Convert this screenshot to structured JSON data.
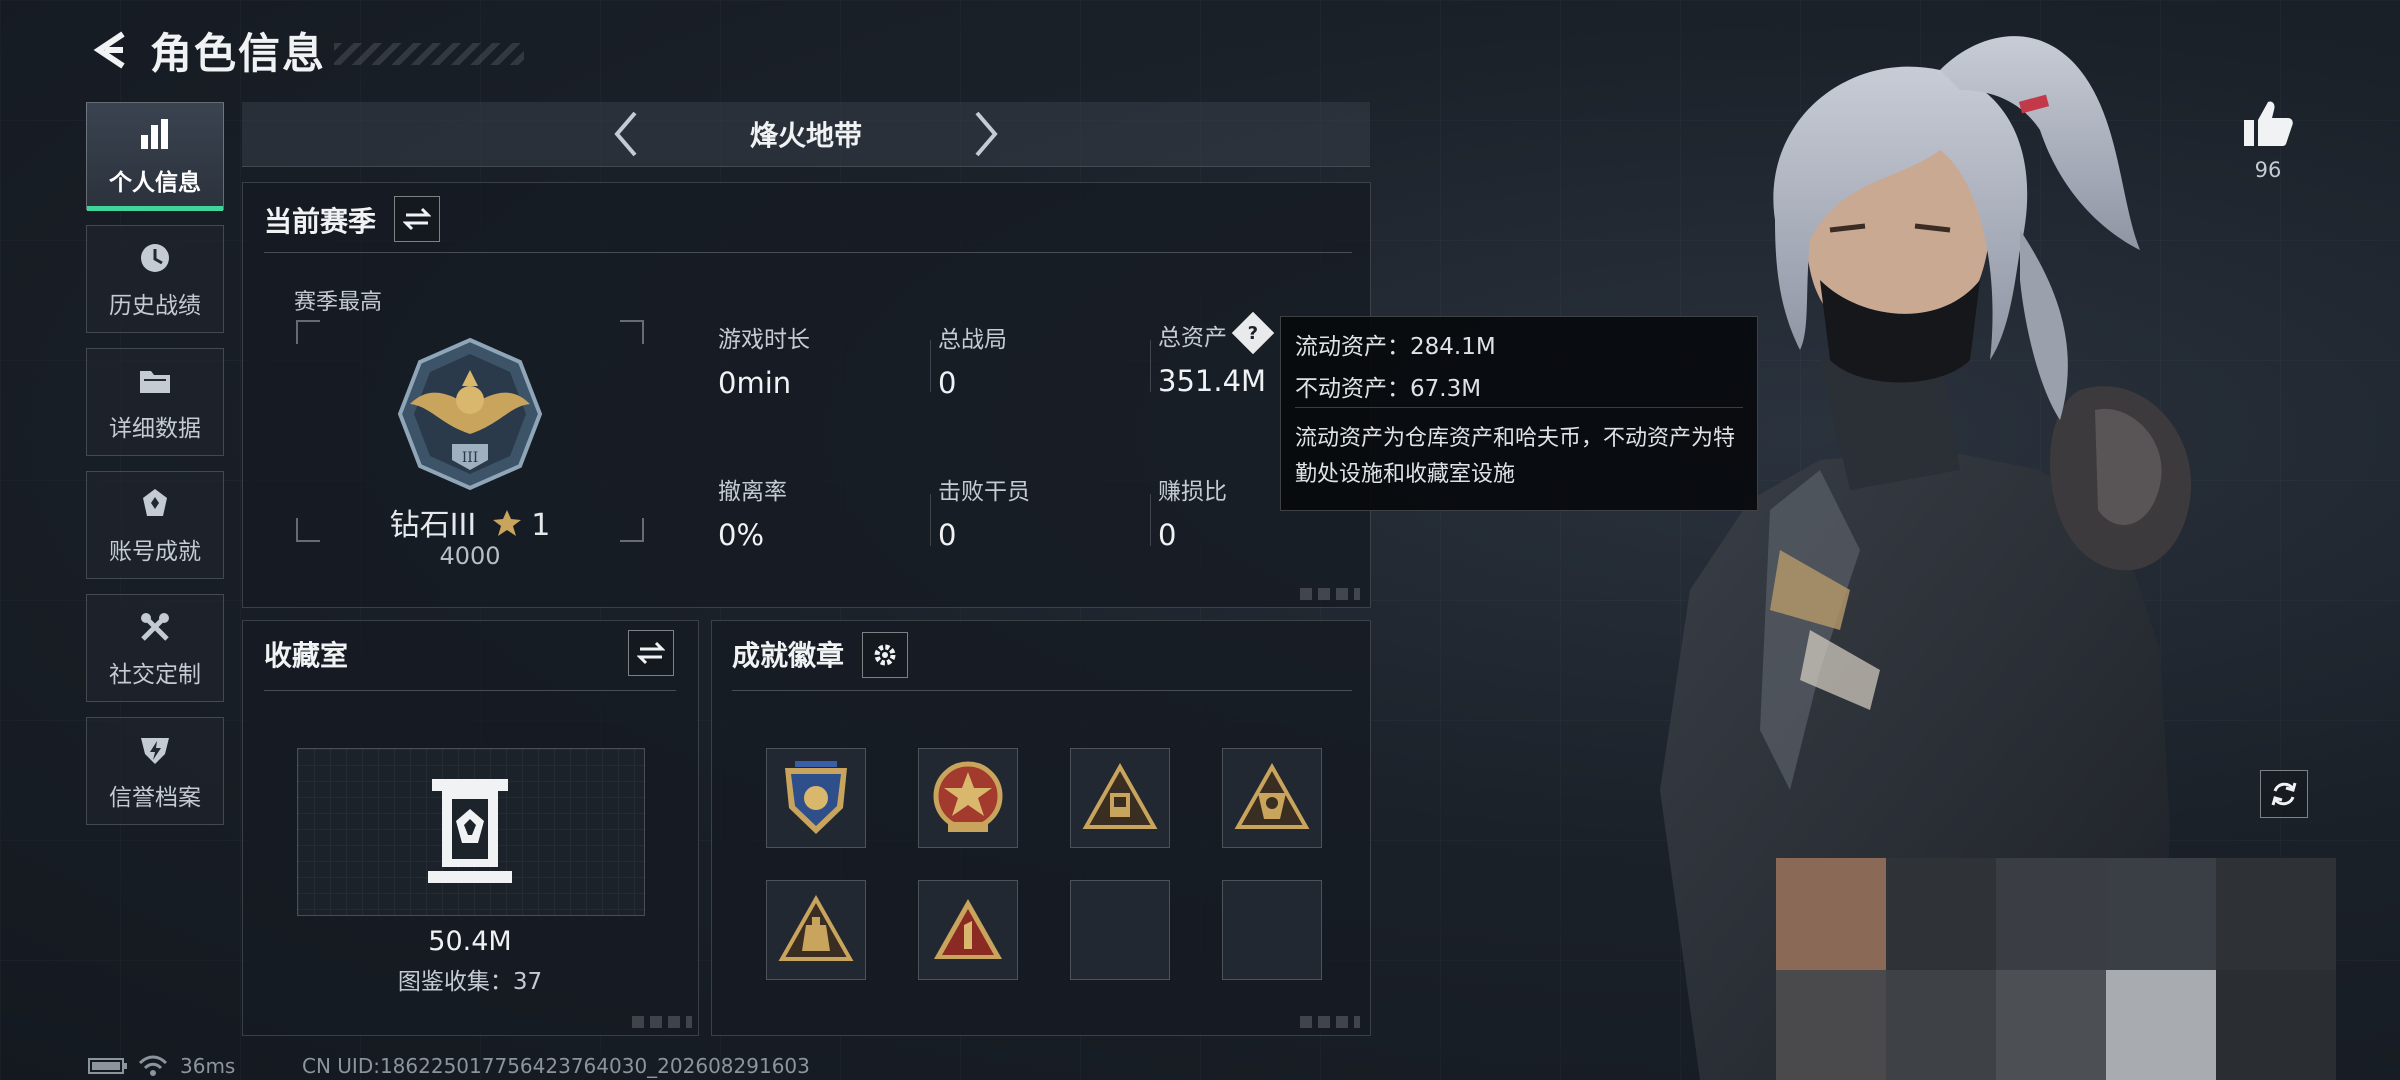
{
  "header": {
    "title": "角色信息"
  },
  "sidenav": {
    "items": [
      {
        "label": "个人信息",
        "icon": "bar-chart-icon",
        "active": true
      },
      {
        "label": "历史战绩",
        "icon": "history-icon",
        "active": false
      },
      {
        "label": "详细数据",
        "icon": "folder-icon",
        "active": false
      },
      {
        "label": "账号成就",
        "icon": "achievement-icon",
        "active": false
      },
      {
        "label": "社交定制",
        "icon": "tools-icon",
        "active": false
      },
      {
        "label": "信誉档案",
        "icon": "shield-icon",
        "active": false
      }
    ]
  },
  "mode": {
    "title": "烽火地带"
  },
  "season": {
    "title": "当前赛季",
    "highest_label": "赛季最高",
    "rank_name": "钻石III",
    "rank_stars": "1",
    "rank_score": "4000",
    "stats": [
      {
        "label": "游戏时长",
        "value": "0min"
      },
      {
        "label": "总战局",
        "value": "0"
      },
      {
        "label": "总资产",
        "value": "351.4M"
      },
      {
        "label": "撤离率",
        "value": "0%"
      },
      {
        "label": "击败干员",
        "value": "0"
      },
      {
        "label": "赚损比",
        "value": "0"
      }
    ]
  },
  "tooltip": {
    "liquid": "流动资产：284.1M",
    "fixed": "不动资产：67.3M",
    "description": "流动资产为仓库资产和哈夫币，不动资产为特勤处设施和收藏室设施"
  },
  "collection": {
    "title": "收藏室",
    "value": "50.4M",
    "count": "图鉴收集：37"
  },
  "badges": {
    "title": "成就徽章",
    "slots": [
      "shield-badge",
      "star-badge",
      "triangle-badge-a",
      "triangle-badge-b",
      "triangle-badge-c",
      "triangle-badge-one",
      "empty",
      "empty"
    ]
  },
  "footer": {
    "ping": "36ms",
    "uid": "CN UID:18622501775642376403​0_202608291603"
  },
  "likes": {
    "count": "96"
  },
  "colors": {
    "accent": "#3fd49a",
    "gold": "#c9a45c"
  }
}
